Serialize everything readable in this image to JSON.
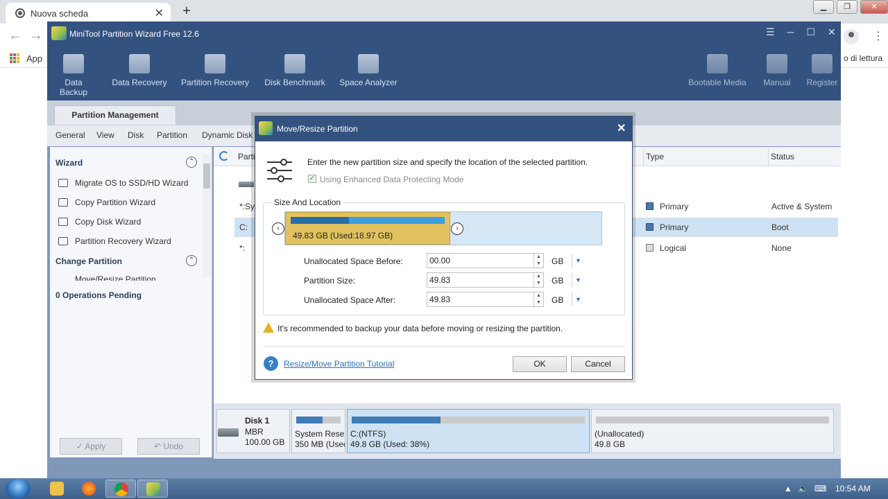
{
  "browser": {
    "tab_title": "Nuova scheda",
    "tab_close": "✕",
    "new_tab": "+",
    "bookmarks_apps": "App",
    "reading_list": "o di lettura",
    "win_min": "▁",
    "win_max": "❐",
    "win_close": "✕",
    "back": "←",
    "forward": "→",
    "menu": "⋮"
  },
  "app": {
    "title": "MiniTool Partition Wizard Free 12.6",
    "window_buttons": [
      "☰",
      "─",
      "☐",
      "✕"
    ],
    "toolbar_left": [
      "Data Backup",
      "Data Recovery",
      "Partition Recovery",
      "Disk Benchmark",
      "Space Analyzer"
    ],
    "toolbar_right": [
      "Bootable Media",
      "Manual",
      "Register"
    ],
    "main_tab": "Partition Management",
    "menu": [
      "General",
      "View",
      "Disk",
      "Partition",
      "Dynamic Disk"
    ]
  },
  "left_panel": {
    "wizard_title": "Wizard",
    "wizard_items": [
      "Migrate OS to SSD/HD Wizard",
      "Copy Partition Wizard",
      "Copy Disk Wizard",
      "Partition Recovery Wizard"
    ],
    "change_title": "Change Partition",
    "change_items": [
      "Move/Resize Partition"
    ],
    "collapse": "⌃",
    "pending": "0 Operations Pending",
    "apply": "✓ Apply",
    "undo": "↶ Undo"
  },
  "grid": {
    "headers": [
      "Parti",
      "Type",
      "Status"
    ],
    "rows": [
      {
        "partition": "*:Sys",
        "type": "Primary",
        "status": "Active & System"
      },
      {
        "partition": "C:",
        "type": "Primary",
        "status": "Boot"
      },
      {
        "partition": "*:",
        "type": "Logical",
        "status": "None"
      }
    ]
  },
  "disk_map": {
    "disk_name": "Disk 1",
    "disk_style": "MBR",
    "disk_size": "100.00 GB",
    "partitions": [
      {
        "name": "System Reser",
        "detail": "350 MB (Usec",
        "used_fraction": 0.6
      },
      {
        "name": "C:(NTFS)",
        "detail": "49.8 GB (Used: 38%)",
        "used_fraction": 0.38
      },
      {
        "name": "(Unallocated)",
        "detail": "49.8 GB",
        "used_fraction": 0
      }
    ]
  },
  "dialog": {
    "title": "Move/Resize Partition",
    "close": "✕",
    "description": "Enter the new partition size and specify the location of the selected partition.",
    "checkbox_label": "Using Enhanced Data Protecting Mode",
    "checkbox_mark": "✓",
    "group_title": "Size And Location",
    "partition_label": "49.83 GB (Used:18.97 GB)",
    "used_fraction": 0.38,
    "arrow_left": "‹",
    "arrow_right": "›",
    "fields": [
      {
        "label": "Unallocated Space Before:",
        "value": "00.00",
        "unit": "GB"
      },
      {
        "label": "Partition Size:",
        "value": "49.83",
        "unit": "GB"
      },
      {
        "label": "Unallocated Space After:",
        "value": "49.83",
        "unit": "GB"
      }
    ],
    "spin_up": "▲",
    "spin_down": "▼",
    "unit_drop": "▼",
    "warning": "It's recommended to backup your data before moving or resizing the partition.",
    "help_symbol": "?",
    "help_link": "Resize/Move Partition Tutorial",
    "ok": "OK",
    "cancel": "Cancel"
  },
  "taskbar": {
    "clock": "10:54 AM",
    "tray_icons": [
      "▲",
      "🔈",
      "⌨"
    ]
  }
}
